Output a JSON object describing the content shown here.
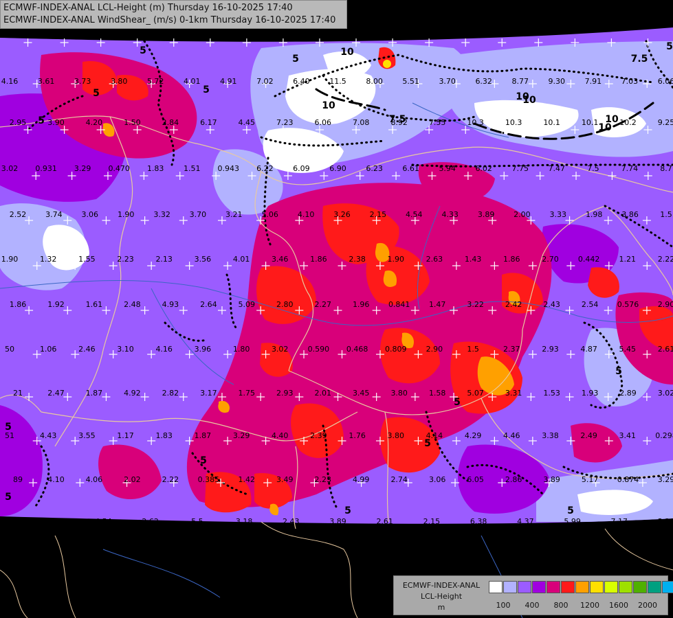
{
  "header": {
    "line1": "ECMWF-INDEX-ANAL LCL-Height (m) Thursday 16-10-2025 17:40",
    "line2": "ECMWF-INDEX-ANAL WindShear_ (m/s) 0-1km Thursday 16-10-2025 17:40"
  },
  "legend": {
    "title1": "ECMWF-INDEX-ANAL",
    "title2": "LCL-Height",
    "unit": "m",
    "colors": [
      "#ffffff",
      "#b2b2ff",
      "#9b5cff",
      "#a000e0",
      "#d8007a",
      "#ff1a1a",
      "#ffa000",
      "#ffe000",
      "#d8ff00",
      "#9ee000",
      "#4fb000",
      "#00a080",
      "#00b0f0"
    ],
    "ticks": [
      "100",
      "400",
      "800",
      "1200",
      "1600",
      "2000"
    ]
  },
  "contours": {
    "labels": [
      "5",
      "5",
      "5",
      "5",
      "5",
      "7.5",
      "10",
      "10",
      "7.5",
      "10",
      "10",
      "5",
      "5",
      "5",
      "5",
      "5",
      "5",
      "5",
      "5",
      "5",
      "10",
      "10"
    ]
  },
  "values": [
    "4.16",
    "3.61",
    "3.73",
    "3.80",
    "5.72",
    "4.01",
    "4.91",
    "7.02",
    "6.40",
    "11.5",
    "8.00",
    "5.51",
    "3.70",
    "6.32",
    "8.77",
    "9.30",
    "7.91",
    "7.03",
    "6.06",
    "2.95",
    "3.90",
    "4.20",
    "1.50",
    "2.84",
    "6.17",
    "4.45",
    "7.23",
    "6.06",
    "7.08",
    "8.92",
    "7.55",
    "10.3",
    "10.3",
    "10.1",
    "10.1",
    "10.2",
    "9.25",
    "3.02",
    "0.931",
    "3.29",
    "0.470",
    "1.83",
    "1.51",
    "0.943",
    "6.22",
    "6.09",
    "6.90",
    "6.23",
    "6.61",
    "5.94",
    "6.02",
    "7.75",
    "7.47",
    "7.5",
    "7.74",
    "8.7",
    "2.52",
    "3.74",
    "3.06",
    "1.90",
    "3.32",
    "3.70",
    "3.21",
    "5.06",
    "4.10",
    "3.26",
    "2.15",
    "4.54",
    "4.33",
    "3.89",
    "2.00",
    "3.33",
    "1.98",
    "3.86",
    "1.5",
    "1.90",
    "1.32",
    "1.55",
    "2.23",
    "2.13",
    "3.56",
    "4.01",
    "3.46",
    "1.86",
    "2.38",
    "1.90",
    "2.63",
    "1.43",
    "1.86",
    "2.70",
    "0.442",
    "1.21",
    "2.22",
    "1.86",
    "1.92",
    "1.61",
    "2.48",
    "4.93",
    "2.64",
    "5.09",
    "2.80",
    "2.27",
    "1.96",
    "0.841",
    "1.47",
    "3.22",
    "2.42",
    "2.43",
    "2.54",
    "0.576",
    "2.90",
    "50",
    "1.06",
    "2.46",
    "3.10",
    "4.16",
    "3.96",
    "1.80",
    "3.02",
    "0.590",
    "0.468",
    "0.809",
    "2.90",
    "1.5",
    "2.37",
    "2.93",
    "4.87",
    "5.45",
    "2.61",
    "21",
    "2.47",
    "1.87",
    "4.92",
    "2.82",
    "3.17",
    "1.75",
    "2.93",
    "2.01",
    "3.45",
    "3.80",
    "1.58",
    "5.07",
    "3.31",
    "1.53",
    "1.93",
    "2.89",
    "3.02",
    "51",
    "4.43",
    "3.55",
    "1.17",
    "1.83",
    "1.87",
    "3.29",
    "4.40",
    "2.39",
    "1.76",
    "3.80",
    "4.14",
    "4.29",
    "4.46",
    "3.38",
    "2.49",
    "3.41",
    "0.298",
    "89",
    "4.10",
    "4.06",
    "2.02",
    "2.22",
    "0.385",
    "1.42",
    "3.49",
    "2.23",
    "4.99",
    "2.74",
    "3.06",
    "6.05",
    "2.86",
    "3.89",
    "5.17",
    "0.874",
    "3.29",
    "4.85",
    "3.51",
    "4.54",
    "2.62",
    "5.5",
    "3.18",
    "2.43",
    "3.89",
    "2.61",
    "2.15",
    "6.38",
    "4.37",
    "5.99",
    "7.17",
    "3.20"
  ]
}
